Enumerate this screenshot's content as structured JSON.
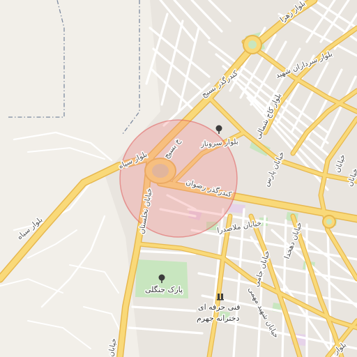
{
  "map": {
    "colors": {
      "background": "#f2efe9",
      "major_road": "#f9d979",
      "major_road_casing": "#e7b84f",
      "minor_road": "#ffffff",
      "minor_road_casing": "#d8d3cc",
      "park": "#c8e6bf",
      "radius_fill": "#f28b8b",
      "radius_stroke": "#e05a5a",
      "boundary": "#7d8aa0"
    },
    "labels": {
      "blvd_zahra": "بلوار زهرا",
      "blvd_sardaran_shahid": "بلوار سرداران شهید",
      "kandargar_basij": "کندرگذر بسیج",
      "blvd_kaj_shomali": "بلوار کاج شمالی",
      "blvd_sarvnaz": "بلوار سروناز",
      "blvd_siah_upper": "بلوار سیاه",
      "kh_basij": "خ بسیج",
      "kh_pars": "خیابان پارس",
      "kandargar_rezvan": "کندرگذر رضوان",
      "kh_nakhlestan": "خیابان نخلستان",
      "kh_mollasadra": "خیابان ملاصدرا",
      "blvd_siah_lower": "بلوار سیاه",
      "kh_dehkhoda": "خیابان دهخدا",
      "kh_jami": "خیابان جامی",
      "kh_shahid_mahmi": "خیابان شهید مهمی",
      "park_jangali": "پارک جنگلی",
      "school_line1": "فنی حرفه ای",
      "school_line2": "دخترانه جهرم",
      "kh_right_top": "خیابان",
      "kh_right_mid": "خیابان",
      "kh_bottom_left": "خیابان",
      "kh_bottom_right": "بلوار"
    },
    "icons": {
      "park_icon_top": "tree-icon",
      "park_icon_bottom": "tree-icon",
      "school_icon": "school-icon"
    }
  }
}
